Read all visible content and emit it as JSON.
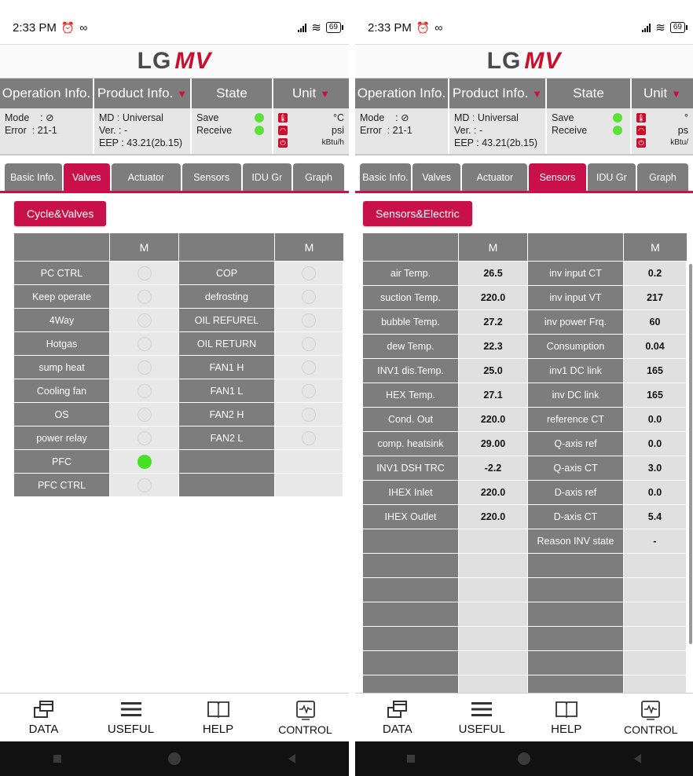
{
  "left": {
    "status": {
      "time": "2:33 PM",
      "battery": "69"
    },
    "logo": {
      "lg": "LG",
      "mv": "MV"
    },
    "info_headers": [
      "Operation Info.",
      "Product Info.",
      "State",
      "Unit"
    ],
    "operation": {
      "mode": "Mode    : ⊘",
      "error": "Error  : 21-1"
    },
    "product": {
      "md": "MD : Universal",
      "ver": "Ver. : -",
      "eep": "EEP : 43.21(2b.15)"
    },
    "state": {
      "save": "Save",
      "receive": "Receive"
    },
    "units": {
      "temp": "°C",
      "pressure": "psi",
      "capacity": "kBtu/h"
    },
    "tabs": [
      "Basic Info.",
      "Valves",
      "Actuator",
      "Sensors",
      "IDU Gr",
      "Graph"
    ],
    "active_tab": "Valves",
    "section": "Cycle&Valves",
    "col_header": "M",
    "rows": [
      {
        "a": "PC CTRL",
        "a_on": false,
        "b": "COP",
        "b_on": false
      },
      {
        "a": "Keep operate",
        "a_on": false,
        "b": "defrosting",
        "b_on": false
      },
      {
        "a": "4Way",
        "a_on": false,
        "b": "OIL REFUREL",
        "b_on": false
      },
      {
        "a": "Hotgas",
        "a_on": false,
        "b": "OIL RETURN",
        "b_on": false
      },
      {
        "a": "sump heat",
        "a_on": false,
        "b": "FAN1 H",
        "b_on": false
      },
      {
        "a": "Cooling fan",
        "a_on": false,
        "b": "FAN1 L",
        "b_on": false
      },
      {
        "a": "OS",
        "a_on": false,
        "b": "FAN2 H",
        "b_on": false
      },
      {
        "a": "power relay",
        "a_on": false,
        "b": "FAN2 L",
        "b_on": false
      },
      {
        "a": "PFC",
        "a_on": true,
        "b": "",
        "b_on": null
      },
      {
        "a": "PFC CTRL",
        "a_on": false,
        "b": "",
        "b_on": null
      }
    ],
    "nav": [
      "DATA",
      "USEFUL",
      "HELP",
      "CONTROL"
    ]
  },
  "right": {
    "status": {
      "time": "2:33 PM",
      "battery": "69"
    },
    "logo": {
      "lg": "LG",
      "mv": "MV"
    },
    "info_headers": [
      "Operation Info.",
      "Product Info.",
      "State",
      "Unit"
    ],
    "operation": {
      "mode": "Mode    : ⊘",
      "error": "Error  : 21-1"
    },
    "product": {
      "md": "MD : Universal",
      "ver": "Ver. : -",
      "eep": "EEP : 43.21(2b.15)"
    },
    "state": {
      "save": "Save",
      "receive": "Receive"
    },
    "units": {
      "temp": "°",
      "pressure": "ps",
      "capacity": "kBtu/"
    },
    "tabs": [
      "Basic Info.",
      "Valves",
      "Actuator",
      "Sensors",
      "IDU Gr",
      "Graph"
    ],
    "active_tab": "Sensors",
    "section": "Sensors&Electric",
    "col_header": "M",
    "rows": [
      {
        "a": "air Temp.",
        "av": "26.5",
        "b": "inv input CT",
        "bv": "0.2"
      },
      {
        "a": "suction Temp.",
        "av": "220.0",
        "b": "inv input VT",
        "bv": "217"
      },
      {
        "a": "bubble Temp.",
        "av": "27.2",
        "b": "inv power Frq.",
        "bv": "60"
      },
      {
        "a": "dew Temp.",
        "av": "22.3",
        "b": "Consumption",
        "bv": "0.04"
      },
      {
        "a": "INV1 dis.Temp.",
        "av": "25.0",
        "b": "inv1 DC link",
        "bv": "165"
      },
      {
        "a": "HEX Temp.",
        "av": "27.1",
        "b": "inv DC link",
        "bv": "165"
      },
      {
        "a": "Cond. Out",
        "av": "220.0",
        "b": "reference CT",
        "bv": "0.0"
      },
      {
        "a": "comp. heatsink",
        "av": "29.00",
        "b": "Q-axis ref",
        "bv": "0.0"
      },
      {
        "a": "INV1 DSH TRC",
        "av": "-2.2",
        "b": "Q-axis CT",
        "bv": "3.0"
      },
      {
        "a": "IHEX Inlet",
        "av": "220.0",
        "b": "D-axis ref",
        "bv": "0.0"
      },
      {
        "a": "IHEX Outlet",
        "av": "220.0",
        "b": "D-axis CT",
        "bv": "5.4"
      },
      {
        "a": "",
        "av": "",
        "b": "Reason INV state",
        "bv": "-"
      },
      {
        "a": "",
        "av": "",
        "b": "",
        "bv": ""
      },
      {
        "a": "",
        "av": "",
        "b": "",
        "bv": ""
      },
      {
        "a": "",
        "av": "",
        "b": "",
        "bv": ""
      },
      {
        "a": "",
        "av": "",
        "b": "",
        "bv": ""
      },
      {
        "a": "",
        "av": "",
        "b": "",
        "bv": ""
      },
      {
        "a": "",
        "av": "",
        "b": "",
        "bv": ""
      }
    ],
    "nav": [
      "DATA",
      "USEFUL",
      "HELP",
      "CONTROL"
    ]
  }
}
